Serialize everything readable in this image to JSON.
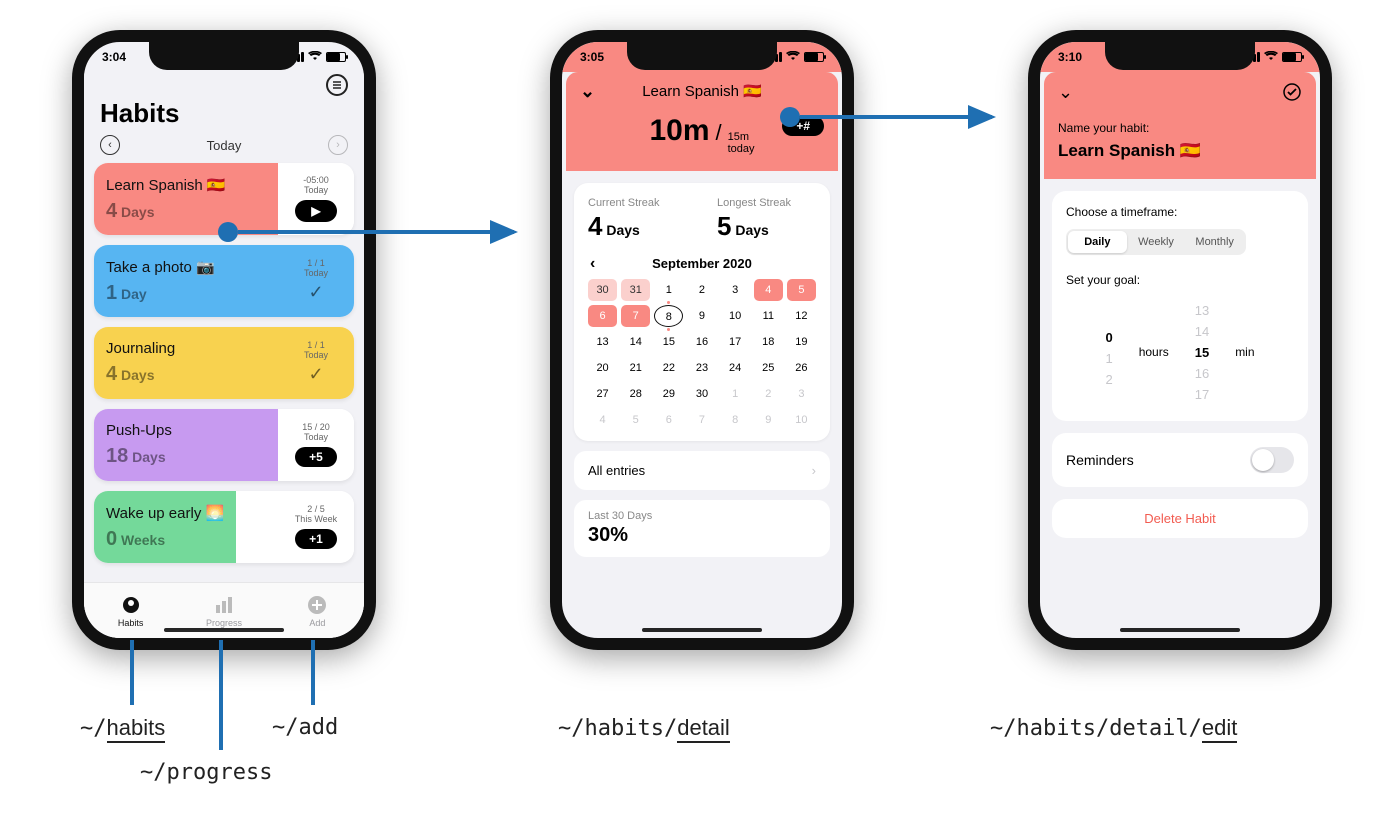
{
  "phone1": {
    "time": "3:04",
    "title": "Habits",
    "nav_label": "Today",
    "tabs": {
      "habits": "Habits",
      "progress": "Progress",
      "add": "Add"
    },
    "cards": [
      {
        "title": "Learn Spanish 🇪🇸",
        "count_n": "4",
        "count_u": "Days",
        "meta1": "-05:00",
        "meta2": "Today",
        "action_kind": "play"
      },
      {
        "title": "Take a photo 📷",
        "count_n": "1",
        "count_u": "Day",
        "meta1": "1 / 1",
        "meta2": "Today",
        "action_kind": "check"
      },
      {
        "title": "Journaling",
        "count_n": "4",
        "count_u": "Days",
        "meta1": "1 / 1",
        "meta2": "Today",
        "action_kind": "check"
      },
      {
        "title": "Push-Ups",
        "count_n": "18",
        "count_u": "Days",
        "meta1": "15 / 20",
        "meta2": "Today",
        "action_kind": "pill",
        "action_label": "+5"
      },
      {
        "title": "Wake up early 🌅",
        "count_n": "0",
        "count_u": "Weeks",
        "meta1": "2 / 5",
        "meta2": "This Week",
        "action_kind": "pill",
        "action_label": "+1"
      }
    ]
  },
  "phone2": {
    "time": "3:05",
    "header_title": "Learn Spanish 🇪🇸",
    "big": "10m",
    "small_top": "15m",
    "small_bot": "today",
    "pill": "+#",
    "streaks": [
      {
        "label": "Current Streak",
        "n": "4",
        "u": "Days"
      },
      {
        "label": "Longest Streak",
        "n": "5",
        "u": "Days"
      }
    ],
    "month": "September 2020",
    "calendar": [
      {
        "t": "30",
        "cls": "mkl"
      },
      {
        "t": "31",
        "cls": "mkl"
      },
      {
        "t": "1",
        "cls": "now-dot"
      },
      {
        "t": "2"
      },
      {
        "t": "3"
      },
      {
        "t": "4",
        "cls": "mk"
      },
      {
        "t": "5",
        "cls": "mk"
      },
      {
        "t": "6",
        "cls": "mk"
      },
      {
        "t": "7",
        "cls": "mk"
      },
      {
        "t": "8",
        "cls": "td now-dot"
      },
      {
        "t": "9"
      },
      {
        "t": "10"
      },
      {
        "t": "11"
      },
      {
        "t": "12"
      },
      {
        "t": "13"
      },
      {
        "t": "14"
      },
      {
        "t": "15"
      },
      {
        "t": "16"
      },
      {
        "t": "17"
      },
      {
        "t": "18"
      },
      {
        "t": "19"
      },
      {
        "t": "20"
      },
      {
        "t": "21"
      },
      {
        "t": "22"
      },
      {
        "t": "23"
      },
      {
        "t": "24"
      },
      {
        "t": "25"
      },
      {
        "t": "26"
      },
      {
        "t": "27"
      },
      {
        "t": "28"
      },
      {
        "t": "29"
      },
      {
        "t": "30"
      },
      {
        "t": "1",
        "cls": "gh"
      },
      {
        "t": "2",
        "cls": "gh"
      },
      {
        "t": "3",
        "cls": "gh"
      },
      {
        "t": "4",
        "cls": "gh"
      },
      {
        "t": "5",
        "cls": "gh"
      },
      {
        "t": "6",
        "cls": "gh"
      },
      {
        "t": "7",
        "cls": "gh"
      },
      {
        "t": "8",
        "cls": "gh"
      },
      {
        "t": "9",
        "cls": "gh"
      },
      {
        "t": "10",
        "cls": "gh"
      }
    ],
    "all_entries": "All entries",
    "last_label": "Last 30 Days",
    "last_value": "30%"
  },
  "phone3": {
    "time": "3:10",
    "name_label": "Name your habit:",
    "name_value": "Learn Spanish 🇪🇸",
    "timeframe_label": "Choose a timeframe:",
    "timeframe_opts": [
      "Daily",
      "Weekly",
      "Monthly"
    ],
    "timeframe_selected": 0,
    "goal_label": "Set your goal:",
    "hours_unit": "hours",
    "min_unit": "min",
    "hours_values": [
      "",
      "",
      "0",
      "1",
      "2"
    ],
    "min_values": [
      "13",
      "14",
      "15",
      "16",
      "17"
    ],
    "reminders": "Reminders",
    "delete": "Delete Habit"
  },
  "routes": {
    "habits": "~/habits",
    "progress": "~/progress",
    "add": "~/add",
    "detail": "~/habits/detail",
    "edit": "~/habits/detail/edit"
  }
}
